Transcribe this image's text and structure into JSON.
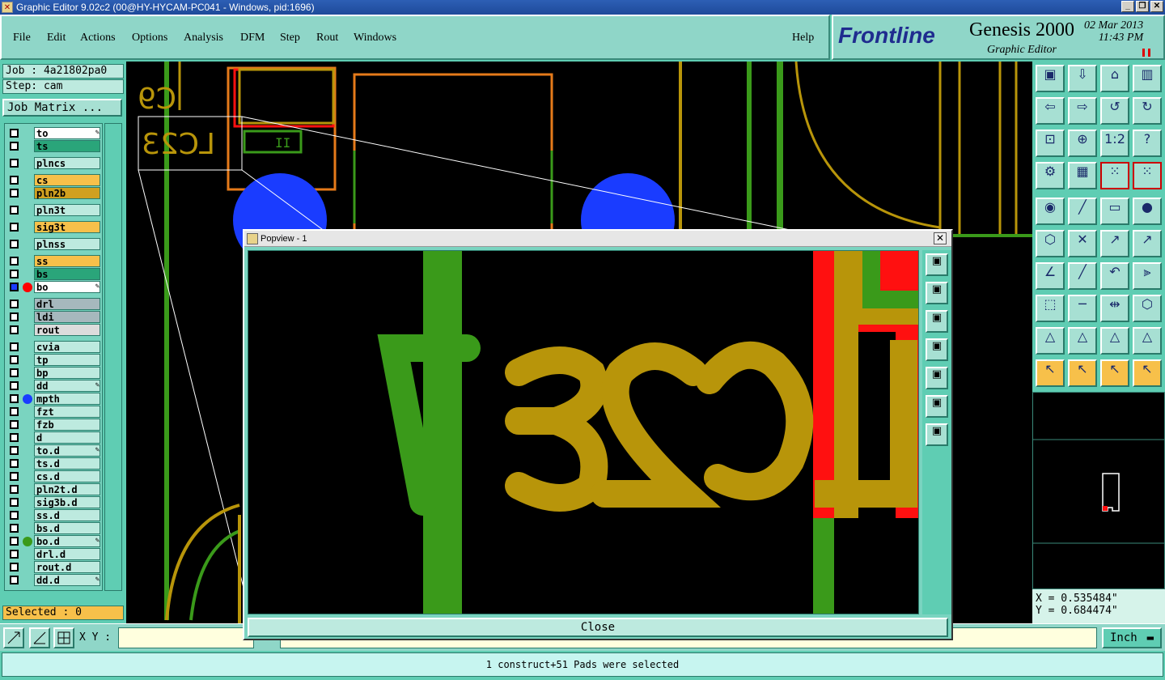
{
  "window": {
    "title": "Graphic Editor 9.02c2 (00@HY-HYCAM-PC041 - Windows, pid:1696)",
    "btn_min": "_",
    "btn_max": "❐",
    "btn_close": "✕"
  },
  "menu": {
    "file": "File",
    "edit": "Edit",
    "actions": "Actions",
    "options": "Options",
    "analysis": "Analysis",
    "dfm": "DFM",
    "step": "Step",
    "rout": "Rout",
    "windows": "Windows",
    "help": "Help"
  },
  "brand": {
    "logo": "Frontline",
    "product": "Genesis 2000",
    "subtitle": "Graphic Editor",
    "date": "02 Mar 2013",
    "time": "11:43 PM"
  },
  "job": {
    "job_label": "Job : 4a21802pa0",
    "step_label": "Step: cam",
    "matrix_button": "Job Matrix ..."
  },
  "layers": [
    {
      "name": "to",
      "color": "#ffffff",
      "pen": true
    },
    {
      "name": "ts",
      "color": "#2aa57a"
    },
    {
      "name": "plncs",
      "color": "#bdeadf"
    },
    {
      "name": "cs",
      "color": "#f7c04a"
    },
    {
      "name": "pln2b",
      "color": "#d0a020"
    },
    {
      "name": "pln3t",
      "color": "#bdeadf"
    },
    {
      "name": "sig3t",
      "color": "#f7c04a"
    },
    {
      "name": "plnss",
      "color": "#bdeadf"
    },
    {
      "name": "ss",
      "color": "#f7c04a"
    },
    {
      "name": "bs",
      "color": "#2aa57a"
    },
    {
      "name": "bo",
      "color": "#ffffff",
      "pen": true,
      "dot": "#ff0000",
      "active": true
    },
    {
      "name": "drl",
      "color": "#a6b8bd"
    },
    {
      "name": "ldi",
      "color": "#a6b8bd"
    },
    {
      "name": "rout",
      "color": "#dcdcdc"
    },
    {
      "name": "cvia",
      "color": "#bdeadf"
    },
    {
      "name": "tp",
      "color": "#bdeadf"
    },
    {
      "name": "bp",
      "color": "#bdeadf"
    },
    {
      "name": "dd",
      "color": "#bdeadf",
      "pen": true
    },
    {
      "name": "mpth",
      "color": "#bdeadf",
      "dot": "#1a3cff"
    },
    {
      "name": "fzt",
      "color": "#bdeadf"
    },
    {
      "name": "fzb",
      "color": "#bdeadf"
    },
    {
      "name": "d",
      "color": "#bdeadf"
    },
    {
      "name": "to.d",
      "color": "#bdeadf",
      "pen": true
    },
    {
      "name": "ts.d",
      "color": "#bdeadf"
    },
    {
      "name": "cs.d",
      "color": "#bdeadf"
    },
    {
      "name": "pln2t.d",
      "color": "#bdeadf"
    },
    {
      "name": "sig3b.d",
      "color": "#bdeadf"
    },
    {
      "name": "ss.d",
      "color": "#bdeadf"
    },
    {
      "name": "bs.d",
      "color": "#bdeadf"
    },
    {
      "name": "bo.d",
      "color": "#bdeadf",
      "pen": true,
      "dot": "#3a9a1a"
    },
    {
      "name": "drl.d",
      "color": "#bdeadf"
    },
    {
      "name": "rout.d",
      "color": "#bdeadf"
    },
    {
      "name": "dd.d",
      "color": "#bdeadf",
      "pen": true
    }
  ],
  "selected": "Selected : 0",
  "canvas": {
    "label_c9": "C9",
    "label_lc23": "LC23",
    "label_ii": "II"
  },
  "popview": {
    "title": "Popview - 1",
    "close_label": "Close",
    "close_x": "✕",
    "text": "LC23"
  },
  "coords": {
    "x": "X = 0.535484\"",
    "y": "Y = 0.684474\""
  },
  "bottom": {
    "xy_label": "X Y :",
    "unit": "Inch"
  },
  "status": "1 construct+51 Pads were selected",
  "colors": {
    "copper": "#b8950a",
    "green": "#3a9a1a",
    "red": "#ff1010",
    "blue": "#1a3cff",
    "orange": "#e57a1a"
  }
}
